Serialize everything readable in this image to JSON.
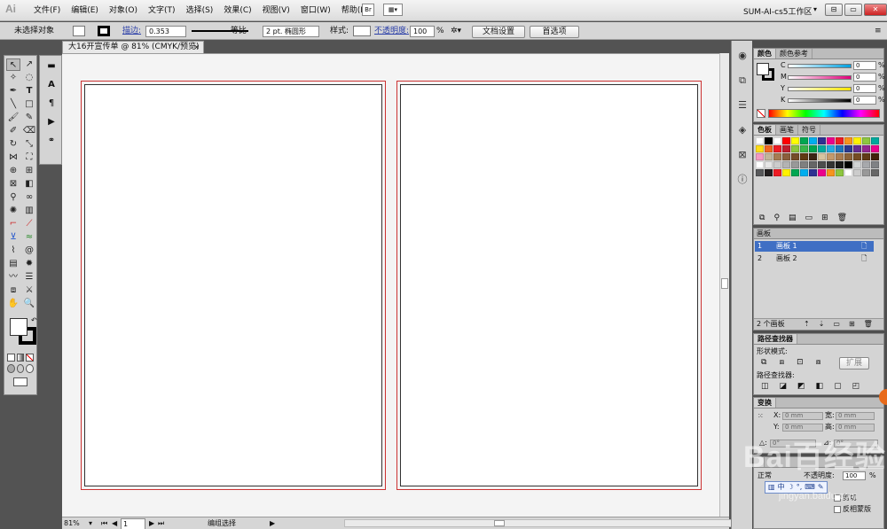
{
  "app": {
    "logo": "Ai",
    "menus": [
      "文件(F)",
      "编辑(E)",
      "对象(O)",
      "文字(T)",
      "选择(S)",
      "效果(C)",
      "视图(V)",
      "窗口(W)",
      "帮助(H)"
    ],
    "bridge_label": "Br",
    "workspace": "SUM-AI-cs5工作区",
    "workspace_arrow": "▾",
    "window_buttons": [
      "⊟",
      "▭",
      "✕"
    ]
  },
  "control": {
    "selection": "未选择对象",
    "stroke_label": "描边:",
    "stroke_weight": "0.353",
    "stroke_profile": "等比",
    "brush": "2 pt. 椭圆形",
    "style_label": "样式:",
    "opacity_label": "不透明度:",
    "opacity_value": "100",
    "opacity_unit": "%",
    "doc_setup_button": "文档设置",
    "prefs_button": "首选项"
  },
  "document": {
    "tab_title": "大16开宣传单 @ 81% (CMYK/预览)",
    "close_glyph": "✕"
  },
  "status": {
    "zoom": "81%",
    "artboard_number": "1",
    "status_text": "编组选择"
  },
  "color_panel": {
    "tabs": [
      "颜色",
      "颜色参考"
    ],
    "channels": [
      {
        "label": "C",
        "value": "0",
        "unit": "%",
        "gradient": "linear-gradient(90deg,#fff,#00a0e0)"
      },
      {
        "label": "M",
        "value": "0",
        "unit": "%",
        "gradient": "linear-gradient(90deg,#fff,#e0007a)"
      },
      {
        "label": "Y",
        "value": "0",
        "unit": "%",
        "gradient": "linear-gradient(90deg,#fff,#ffe600)"
      },
      {
        "label": "K",
        "value": "0",
        "unit": "%",
        "gradient": "linear-gradient(90deg,#fff,#000)"
      }
    ]
  },
  "swatch_panel": {
    "tabs": [
      "色板",
      "画笔",
      "符号"
    ],
    "rows": [
      [
        "#ffffff",
        "#000000",
        "#ffffff",
        "#ff0000",
        "#ffff00",
        "#00a651",
        "#00aeef",
        "#2e3192",
        "#ec008c",
        "#ed1c24",
        "#f7941d",
        "#fff200",
        "#8dc63f",
        "#00a99d"
      ],
      [
        "#ffde17",
        "#f26522",
        "#ed1c24",
        "#be1e2d",
        "#8cc63f",
        "#39b54a",
        "#00a651",
        "#00a99d",
        "#27aae1",
        "#1c75bc",
        "#2b3990",
        "#662d91",
        "#92278f",
        "#ec008c"
      ],
      [
        "#f49ac1",
        "#c2b59b",
        "#a67c52",
        "#8b5e3c",
        "#754c29",
        "#603913",
        "#3c2415",
        "#d7c4a0",
        "#c49a6c",
        "#a97c50",
        "#8b6239",
        "#754c24",
        "#603a17",
        "#42210b"
      ],
      [
        "#ffffff",
        "#e6e6e6",
        "#cccccc",
        "#b3b3b3",
        "#999999",
        "#808080",
        "#666666",
        "#4d4d4d",
        "#333333",
        "#1a1a1a",
        "#000000",
        "#d1d3d4",
        "#a7a9ac",
        "#808285"
      ],
      [
        "#58595b",
        "#231f20",
        "#ed1c24",
        "#fff200",
        "#00a651",
        "#00aeef",
        "#2e3192",
        "#ec008c",
        "#f7941d",
        "#8dc63f",
        "#ffffff",
        "#cccccc",
        "#999999",
        "#666666"
      ]
    ]
  },
  "artboards_panel": {
    "title": "画板",
    "items": [
      {
        "index": "1",
        "name": "画板 1"
      },
      {
        "index": "2",
        "name": "画板 2"
      }
    ],
    "footer": "2 个画板"
  },
  "pathfinder_panel": {
    "title": "路径查找器",
    "shape_modes_label": "形状模式:",
    "expand_button": "扩展",
    "pathfinders_label": "路径查找器:"
  },
  "transform_panel": {
    "title": "变换",
    "x_label": "X:",
    "x_value": "0 mm",
    "y_label": "Y:",
    "y_value": "0 mm",
    "w_label": "宽:",
    "w_value": "0 mm",
    "h_label": "高:",
    "h_value": "0 mm",
    "angle_label": "△:",
    "angle_value": "0°",
    "shear_label": "⊿:",
    "shear_value": "0°"
  },
  "transparency_panel": {
    "mode_label": "正常",
    "opacity_label": "不透明度:",
    "opacity_value": "100",
    "opacity_unit": "%",
    "clip_label": "剪切",
    "invert_mask_label": "反相蒙版"
  },
  "overlay": {
    "watermark": "Bai百经验",
    "watermark_url": "jingyan.baidu.com",
    "ime_items": [
      "中",
      "☽",
      "°,",
      "⌨",
      "✎"
    ]
  }
}
